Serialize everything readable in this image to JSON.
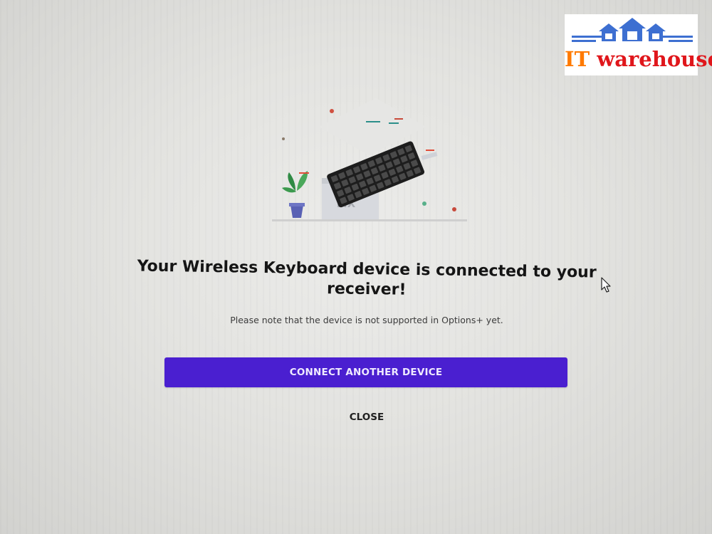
{
  "dialog": {
    "illustration_badge": "MX",
    "title": "Your Wireless Keyboard device is connected to your receiver!",
    "subtitle": "Please note that the device is not supported in Options+ yet.",
    "primary_button": "CONNECT ANOTHER DEVICE",
    "close_button": "CLOSE"
  },
  "watermark": {
    "prefix": "IT",
    "suffix": " warehouse"
  },
  "colors": {
    "accent": "#4a1fd0",
    "logo_orange": "#ff7a00",
    "logo_red": "#e0161b",
    "logo_blue": "#3d6fd1"
  },
  "icons": [
    "keyboard-illustration",
    "plant-icon",
    "mouse-cursor-icon",
    "houses-logo-icon"
  ]
}
